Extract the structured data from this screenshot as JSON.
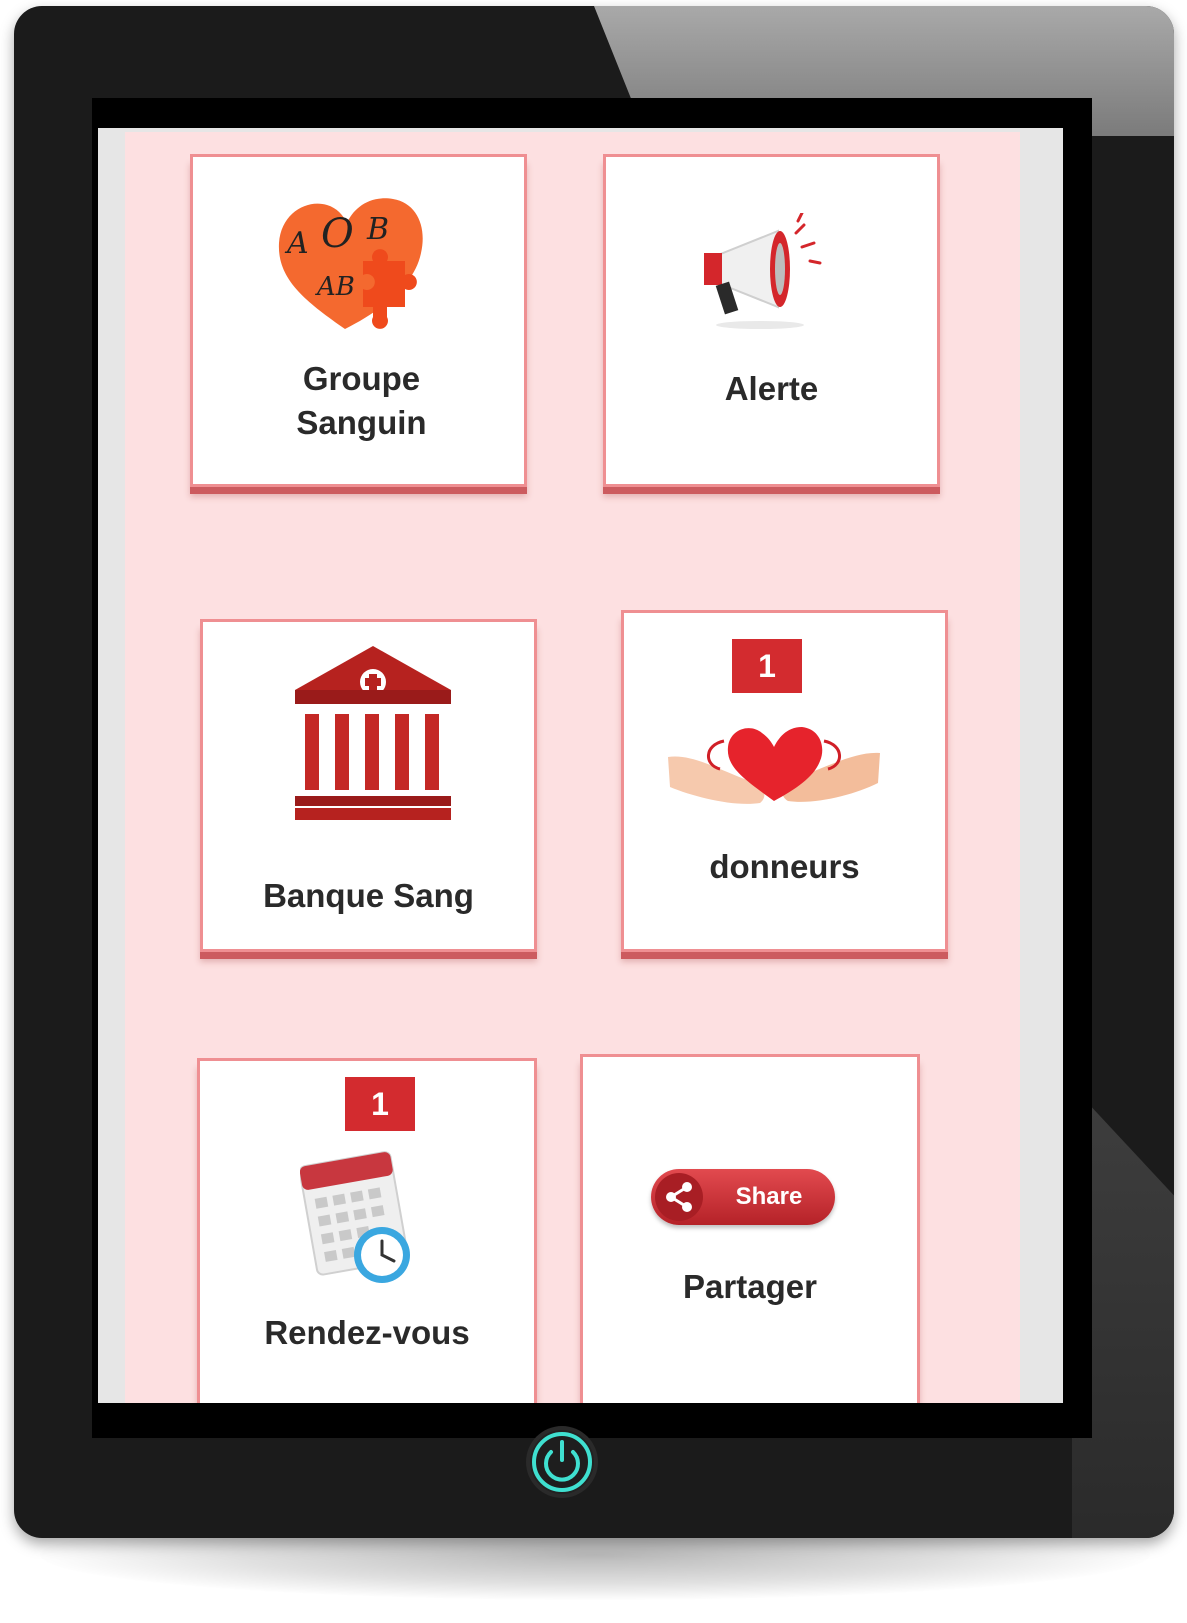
{
  "cards": [
    {
      "label": "Groupe Sanguin",
      "icon": "blood-group-heart-icon"
    },
    {
      "label": "Alerte",
      "icon": "megaphone-icon"
    },
    {
      "label": "Banque Sang",
      "icon": "blood-bank-building-icon"
    },
    {
      "label": "donneurs",
      "icon": "hands-heart-icon",
      "badge": "1"
    },
    {
      "label": "Rendez-vous",
      "icon": "calendar-clock-icon",
      "badge": "1"
    },
    {
      "label": "Partager",
      "icon": "share-button-icon",
      "button_text": "Share"
    }
  ],
  "heart_letters": [
    "A",
    "O",
    "B",
    "AB"
  ],
  "colors": {
    "accent": "#d32b2f",
    "background": "#fde0e1",
    "card_border": "#ef8f92",
    "power_ring": "#3fe0d0"
  }
}
